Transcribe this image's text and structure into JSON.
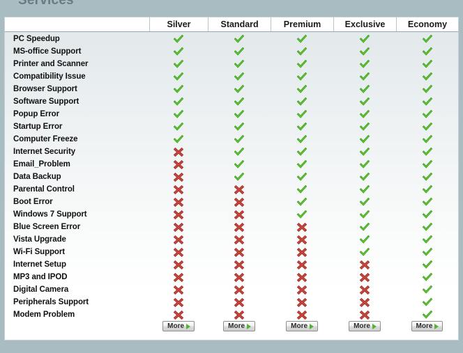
{
  "page": {
    "title": "Services",
    "background_color": "#a8bcc2",
    "panel_background": "#e1e8ea",
    "panel_border_color": "#c3d0d4"
  },
  "table": {
    "row_header_label": "",
    "columns": [
      {
        "label": "Silver",
        "more_label": "More",
        "more_icon": "triangle-right-icon"
      },
      {
        "label": "Standard",
        "more_label": "More",
        "more_icon": "triangle-right-icon"
      },
      {
        "label": "Premium",
        "more_label": "More",
        "more_icon": "triangle-right-icon"
      },
      {
        "label": "Exclusive",
        "more_label": "More",
        "more_icon": "triangle-right-icon"
      },
      {
        "label": "Economy",
        "more_label": "More",
        "more_icon": "triangle-right-icon"
      }
    ],
    "check_color": "#5cc432",
    "cross_color": "#c3453c",
    "check_icon": "check-mark-icon",
    "cross_icon": "cross-mark-icon",
    "rows": [
      {
        "service": "PC Speedup",
        "marks": [
          "check",
          "check",
          "check",
          "check",
          "check"
        ]
      },
      {
        "service": "MS-office Support",
        "marks": [
          "check",
          "check",
          "check",
          "check",
          "check"
        ]
      },
      {
        "service": "Printer and Scanner",
        "marks": [
          "check",
          "check",
          "check",
          "check",
          "check"
        ]
      },
      {
        "service": "Compatibility Issue",
        "marks": [
          "check",
          "check",
          "check",
          "check",
          "check"
        ]
      },
      {
        "service": "Browser Support",
        "marks": [
          "check",
          "check",
          "check",
          "check",
          "check"
        ]
      },
      {
        "service": "Software Support",
        "marks": [
          "check",
          "check",
          "check",
          "check",
          "check"
        ]
      },
      {
        "service": "Popup Error",
        "marks": [
          "check",
          "check",
          "check",
          "check",
          "check"
        ]
      },
      {
        "service": "Startup Error",
        "marks": [
          "check",
          "check",
          "check",
          "check",
          "check"
        ]
      },
      {
        "service": "Computer Freeze",
        "marks": [
          "check",
          "check",
          "check",
          "check",
          "check"
        ]
      },
      {
        "service": "Internet Security",
        "marks": [
          "cross",
          "check",
          "check",
          "check",
          "check"
        ]
      },
      {
        "service": "Email_Problem",
        "marks": [
          "cross",
          "check",
          "check",
          "check",
          "check"
        ]
      },
      {
        "service": "Data Backup",
        "marks": [
          "cross",
          "check",
          "check",
          "check",
          "check"
        ]
      },
      {
        "service": "Parental Control",
        "marks": [
          "cross",
          "cross",
          "check",
          "check",
          "check"
        ]
      },
      {
        "service": "Boot Error",
        "marks": [
          "cross",
          "cross",
          "check",
          "check",
          "check"
        ]
      },
      {
        "service": "Windows 7 Support",
        "marks": [
          "cross",
          "cross",
          "check",
          "check",
          "check"
        ]
      },
      {
        "service": "Blue Screen Error",
        "marks": [
          "cross",
          "cross",
          "cross",
          "check",
          "check"
        ]
      },
      {
        "service": "Vista Upgrade",
        "marks": [
          "cross",
          "cross",
          "cross",
          "check",
          "check"
        ]
      },
      {
        "service": "Wi-Fi Support",
        "marks": [
          "cross",
          "cross",
          "cross",
          "check",
          "check"
        ]
      },
      {
        "service": "Internet Setup",
        "marks": [
          "cross",
          "cross",
          "cross",
          "cross",
          "check"
        ]
      },
      {
        "service": "MP3 and IPOD",
        "marks": [
          "cross",
          "cross",
          "cross",
          "cross",
          "check"
        ]
      },
      {
        "service": "Digital Camera",
        "marks": [
          "cross",
          "cross",
          "cross",
          "cross",
          "check"
        ]
      },
      {
        "service": "Peripherals Support",
        "marks": [
          "cross",
          "cross",
          "cross",
          "cross",
          "check"
        ]
      },
      {
        "service": "Modem Problem",
        "marks": [
          "cross",
          "cross",
          "cross",
          "cross",
          "check"
        ]
      }
    ]
  }
}
